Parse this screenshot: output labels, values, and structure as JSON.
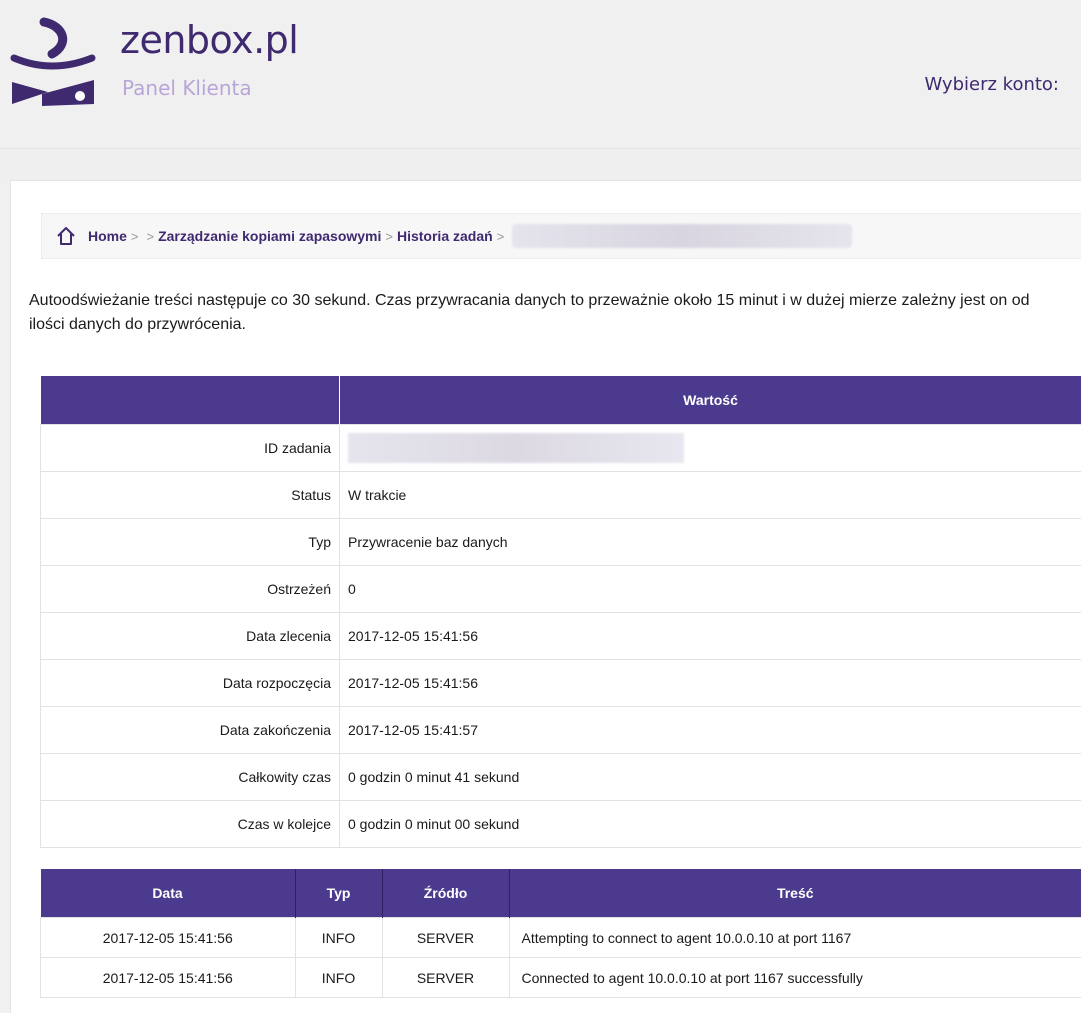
{
  "header": {
    "logo_name": "zenbox.pl",
    "logo_subtitle": "Panel Klienta",
    "choose_account": "Wybierz konto:"
  },
  "breadcrumb": {
    "home": "Home",
    "sep": ">",
    "item_backups": "Zarządzanie kopiami zapasowymi",
    "item_history": "Historia zadań"
  },
  "notice": "Autoodświeżanie treści następuje co 30 sekund. Czas przywracania danych to przeważnie około 15 minut i w dużej mierze zależny jest on od ilości danych do przywrócenia.",
  "details": {
    "header_value": "Wartość",
    "rows": [
      {
        "key": "ID zadania",
        "value": ""
      },
      {
        "key": "Status",
        "value": "W trakcie"
      },
      {
        "key": "Typ",
        "value": "Przywracenie baz danych"
      },
      {
        "key": "Ostrzeżeń",
        "value": "0"
      },
      {
        "key": "Data zlecenia",
        "value": "2017-12-05 15:41:56"
      },
      {
        "key": "Data rozpoczęcia",
        "value": "2017-12-05 15:41:56"
      },
      {
        "key": "Data zakończenia",
        "value": "2017-12-05 15:41:57"
      },
      {
        "key": "Całkowity czas",
        "value": "0 godzin 0 minut 41 sekund"
      },
      {
        "key": "Czas w kolejce",
        "value": "0 godzin 0 minut 00 sekund"
      }
    ]
  },
  "log": {
    "columns": [
      "Data",
      "Typ",
      "Źródło",
      "Treść"
    ],
    "rows": [
      [
        "2017-12-05 15:41:56",
        "INFO",
        "SERVER",
        "Attempting to connect to agent 10.0.0.10 at port 1167"
      ],
      [
        "2017-12-05 15:41:56",
        "INFO",
        "SERVER",
        "Connected to agent 10.0.0.10 at port 1167 successfully"
      ]
    ]
  },
  "colors": {
    "brand": "#3f2a6f",
    "table_header": "#4b3a8d",
    "subtitle": "#b9a6d9"
  }
}
